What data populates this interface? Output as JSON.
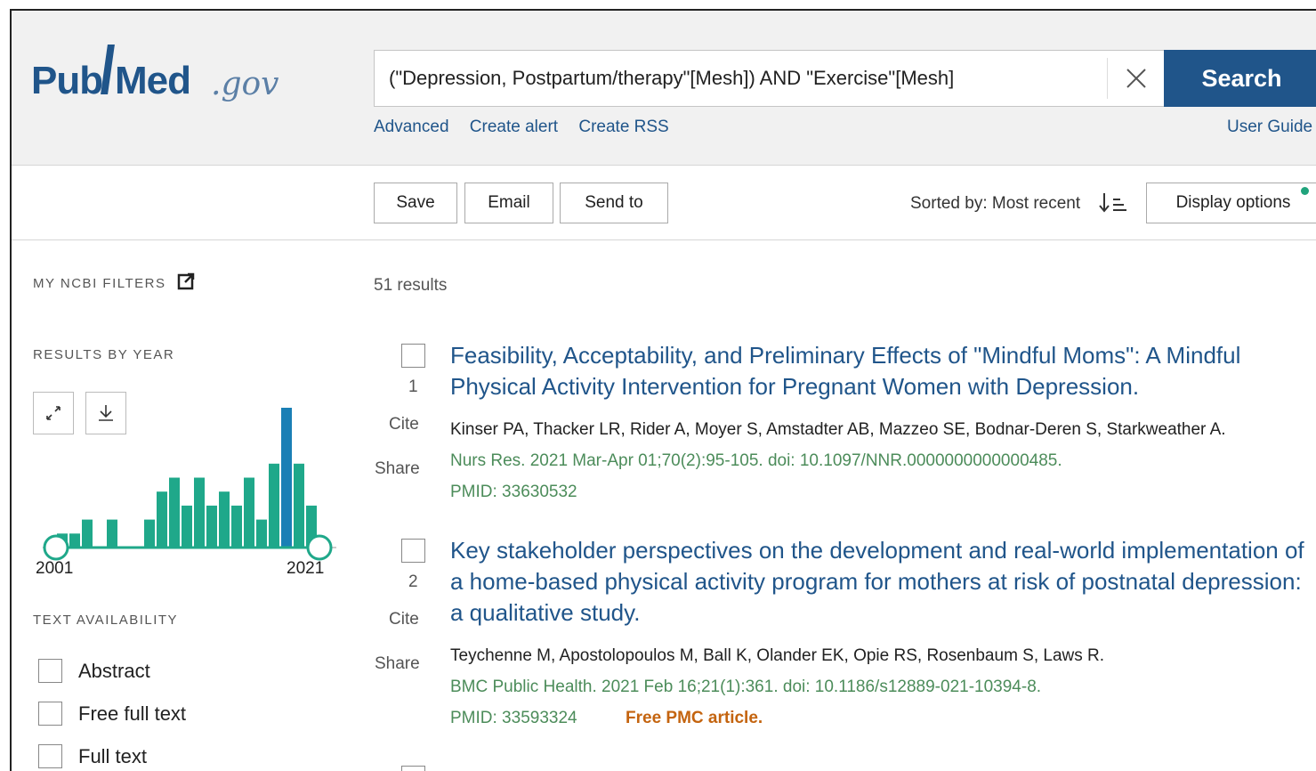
{
  "header": {
    "logo_pub": "Pub",
    "logo_med": "Med",
    "logo_gov": ".gov",
    "search_query": "(\"Depression, Postpartum/therapy\"[Mesh]) AND \"Exercise\"[Mesh]",
    "search_label": "Search",
    "links": [
      "Advanced",
      "Create alert",
      "Create RSS"
    ],
    "user_guide": "User Guide"
  },
  "actions": {
    "save": "Save",
    "email": "Email",
    "send_to": "Send to",
    "sorted_by": "Sorted by: Most recent",
    "display_options": "Display options"
  },
  "sidebar": {
    "my_ncbi_filters": "MY NCBI FILTERS",
    "results_by_year": "RESULTS BY YEAR",
    "year_start": "2001",
    "year_end": "2021",
    "text_availability": "TEXT AVAILABILITY",
    "filters": [
      "Abstract",
      "Free full text",
      "Full text"
    ]
  },
  "chart_data": {
    "type": "bar",
    "categories": [
      "2001",
      "2002",
      "2003",
      "2004",
      "2005",
      "2006",
      "2007",
      "2008",
      "2009",
      "2010",
      "2011",
      "2012",
      "2013",
      "2014",
      "2015",
      "2016",
      "2017",
      "2018",
      "2019",
      "2020",
      "2021"
    ],
    "values": [
      1,
      1,
      2,
      0,
      2,
      0,
      0,
      2,
      4,
      5,
      3,
      5,
      3,
      4,
      3,
      5,
      2,
      6,
      10,
      6,
      3
    ],
    "highlight_index": 18,
    "colors": {
      "bar": "#1fa88a",
      "highlight": "#1a7fb5",
      "track": "#1fa88a"
    }
  },
  "results": {
    "count": "51 results",
    "items": [
      {
        "num": "1",
        "cite": "Cite",
        "share": "Share",
        "title": "Feasibility, Acceptability, and Preliminary Effects of \"Mindful Moms\": A Mindful Physical Activity Intervention for Pregnant Women with Depression.",
        "authors": "Kinser PA, Thacker LR, Rider A, Moyer S, Amstadter AB, Mazzeo SE, Bodnar-Deren S, Starkweather A.",
        "journal": "Nurs Res. 2021 Mar-Apr 01;70(2):95-105. doi: 10.1097/NNR.0000000000000485.",
        "pmid": "PMID: 33630532",
        "free": ""
      },
      {
        "num": "2",
        "cite": "Cite",
        "share": "Share",
        "title": "Key stakeholder perspectives on the development and real-world implementation of a home-based physical activity program for mothers at risk of postnatal depression: a qualitative study.",
        "authors": "Teychenne M, Apostolopoulos M, Ball K, Olander EK, Opie RS, Rosenbaum S, Laws R.",
        "journal": "BMC Public Health. 2021 Feb 16;21(1):361. doi: 10.1186/s12889-021-10394-8.",
        "pmid": "PMID: 33593324",
        "free": "Free PMC article."
      }
    ]
  }
}
